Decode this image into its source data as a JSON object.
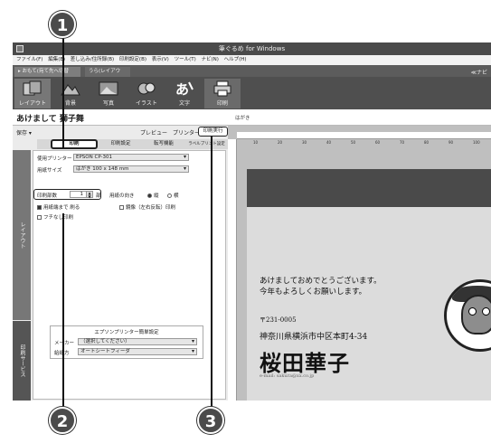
{
  "window": {
    "title": "筆ぐるめ for Windows"
  },
  "menu": [
    "ファイル(F)",
    "編集(E)",
    "差し込み/住所録(B)",
    "印刷設定(B)",
    "表示(V)",
    "ツール(T)",
    "ナビ(N)",
    "ヘルプ(H)"
  ],
  "tabs": {
    "front": "おもて(宛て先へ切替",
    "back": "うら(レイアウト)",
    "navi": "ナビ"
  },
  "ribbon": [
    "レイアウト",
    "背景",
    "写真",
    "イラスト",
    "文字",
    "印刷"
  ],
  "document": {
    "title": "あけまして 獅子舞",
    "canvas_label": "はがき"
  },
  "toolbar": {
    "save": "保存 ▾",
    "preview": "プレビュー",
    "printer_settings": "プリンター設定",
    "print_execute": "印刷実行"
  },
  "subtabs": [
    "印刷",
    "印刷設定",
    "転写機能",
    "ラベルプリント設定"
  ],
  "side_tabs": [
    "レイアウト",
    "印刷サービス"
  ],
  "form": {
    "printer_label": "使用プリンター",
    "printer_value": "EPSON CP-301",
    "paper_label": "用紙サイズ",
    "paper_value": "はがき 100 x 148 mm",
    "copies_label": "印刷部数",
    "copies_value": "1",
    "copies_unit": "部",
    "orientation_label": "用紙の向き",
    "orientation_portrait": "縦",
    "orientation_landscape": "横",
    "fit_label": "用紙端まで 刷る",
    "border_label": "フチなし印刷",
    "mirror_label": "鏡像（左右反転）印刷"
  },
  "easy_settings": {
    "title": "エプソンプリンター簡単設定",
    "maker_label": "メーカー",
    "maker_value": "（選択してください）",
    "feed_label": "給紙方",
    "feed_value": "オートシートフィーダ"
  },
  "card": {
    "greeting_line1": "あけましておめでとうございます。",
    "greeting_line2": "今年もよろしくお願いします。",
    "zip": "〒231-0005",
    "address": "神奈川県横浜市中区本町4-34",
    "name": "桜田華子",
    "email": "e-mail: sakura@xx.co.jp"
  },
  "ruler_marks": [
    "10",
    "20",
    "30",
    "40",
    "50",
    "60",
    "70",
    "80",
    "90",
    "100"
  ],
  "callouts": [
    "1",
    "2",
    "3"
  ]
}
